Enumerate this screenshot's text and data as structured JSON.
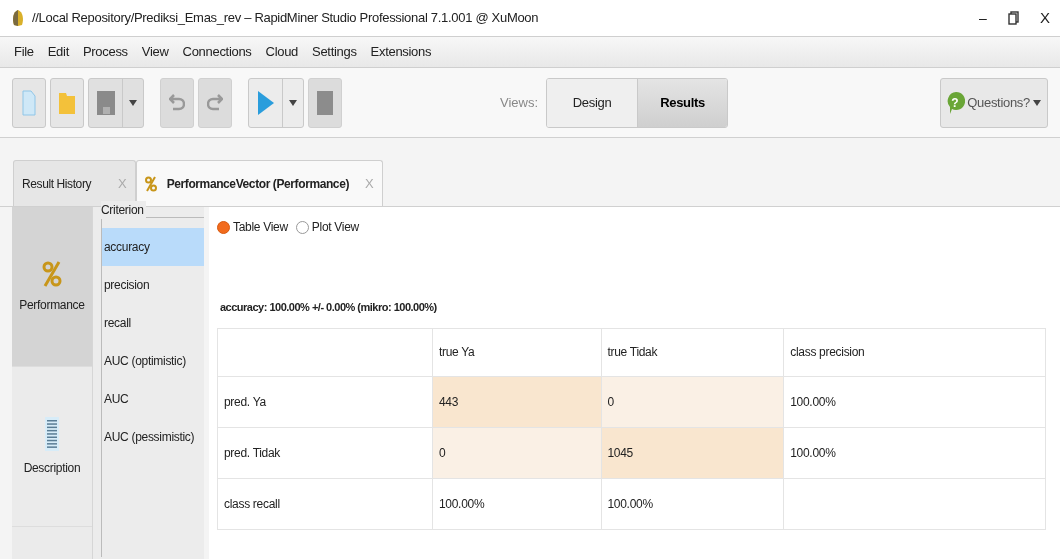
{
  "window": {
    "title": "//Local Repository/Prediksi_Emas_rev – RapidMiner Studio Professional 7.1.001 @ XuMoon",
    "controls": [
      "–",
      "X"
    ]
  },
  "menu": [
    "File",
    "Edit",
    "Process",
    "View",
    "Connections",
    "Cloud",
    "Settings",
    "Extensions"
  ],
  "toolbar": {
    "views_label": "Views:",
    "views": [
      {
        "label": "Design",
        "selected": false
      },
      {
        "label": "Results",
        "selected": true
      }
    ],
    "help": "Questions?",
    "help_glyph": "?"
  },
  "tabs": [
    {
      "label": "Result History",
      "close": "X",
      "selected": false
    },
    {
      "label": "PerformanceVector (Performance)",
      "close": "X",
      "selected": true
    }
  ],
  "sidebar": [
    {
      "label": "Performance",
      "kind": "performance",
      "selected": true
    },
    {
      "label": "Description",
      "kind": "description",
      "selected": false
    }
  ],
  "criterion": {
    "title": "Criterion",
    "items": [
      {
        "label": "accuracy",
        "selected": true
      },
      {
        "label": "precision",
        "selected": false
      },
      {
        "label": "recall",
        "selected": false
      },
      {
        "label": "AUC (optimistic)",
        "selected": false
      },
      {
        "label": "AUC",
        "selected": false
      },
      {
        "label": "AUC (pessimistic)",
        "selected": false
      }
    ]
  },
  "view_options": [
    {
      "label": "Table View",
      "selected": true
    },
    {
      "label": "Plot View",
      "selected": false
    }
  ],
  "summary": "accuracy: 100.00% +/- 0.00% (mikro: 100.00%)",
  "table": {
    "columns": [
      "",
      "true Ya",
      "true Tidak",
      "class precision"
    ],
    "rows": [
      [
        {
          "text": "pred. Ya",
          "kind": "plain"
        },
        {
          "text": "443",
          "kind": "strong"
        },
        {
          "text": "0",
          "kind": "light"
        },
        {
          "text": "100.00%",
          "kind": "plain"
        }
      ],
      [
        {
          "text": "pred. Tidak",
          "kind": "plain"
        },
        {
          "text": "0",
          "kind": "light"
        },
        {
          "text": "1045",
          "kind": "strong"
        },
        {
          "text": "100.00%",
          "kind": "plain"
        }
      ],
      [
        {
          "text": "class recall",
          "kind": "plain"
        },
        {
          "text": "100.00%",
          "kind": "plain"
        },
        {
          "text": "100.00%",
          "kind": "plain"
        },
        {
          "text": "",
          "kind": "plain"
        }
      ]
    ]
  }
}
